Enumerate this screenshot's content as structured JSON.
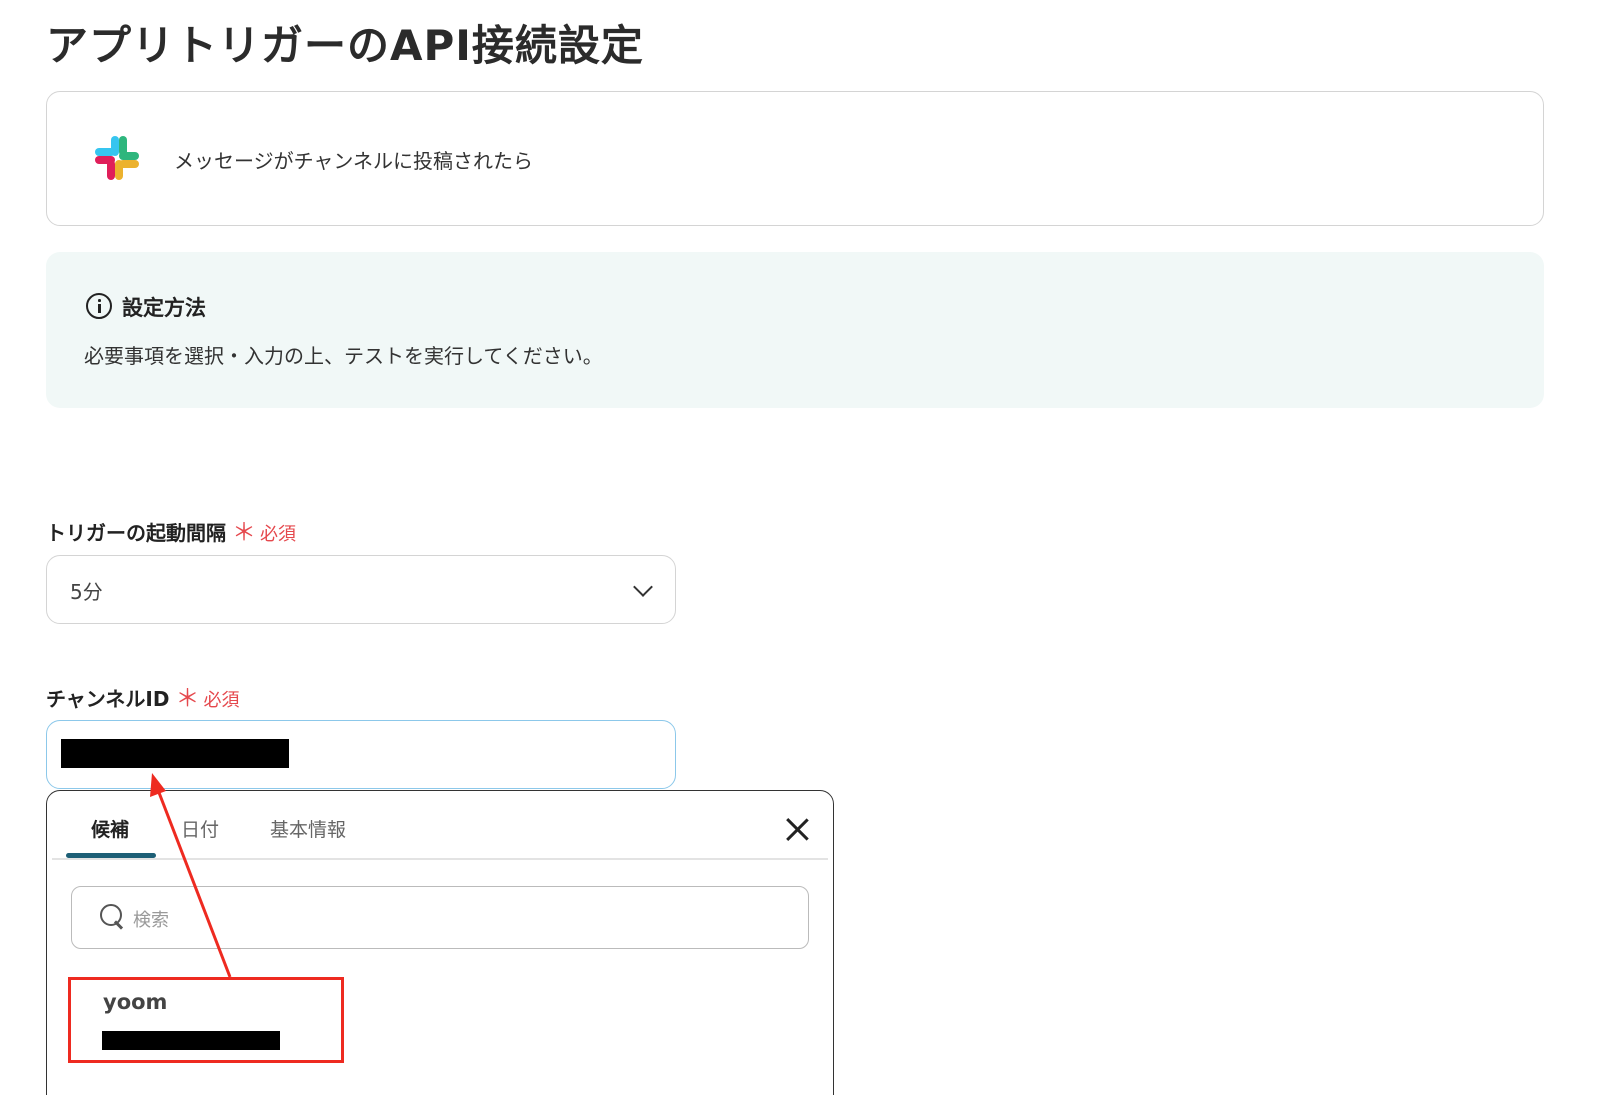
{
  "page": {
    "title": "アプリトリガーのAPI接続設定"
  },
  "trigger_card": {
    "app_icon": "slack-logo",
    "label": "メッセージがチャンネルに投稿されたら"
  },
  "info": {
    "icon": "info-circle-icon",
    "title": "設定方法",
    "body": "必要事項を選択・入力の上、テストを実行してください。"
  },
  "interval_field": {
    "label": "トリガーの起動間隔",
    "required_mark": "＊",
    "required_text": "必須",
    "value": "5分"
  },
  "channel_field": {
    "label": "チャンネルID",
    "required_mark": "＊",
    "required_text": "必須",
    "value_redacted": true
  },
  "popup": {
    "tabs": [
      "候補",
      "日付",
      "基本情報"
    ],
    "active_tab": "候補",
    "search_placeholder": "検索",
    "results": [
      {
        "name": "yoom",
        "id_redacted": true
      }
    ]
  },
  "annotation": {
    "highlight_color": "#ee2a20",
    "arrow_color": "#ee2a20"
  },
  "colors": {
    "required": "#e5484d",
    "tab_active_underline": "#1d5f76",
    "info_bg": "#f1f8f7",
    "input_focus_border": "#8cc8ea"
  }
}
